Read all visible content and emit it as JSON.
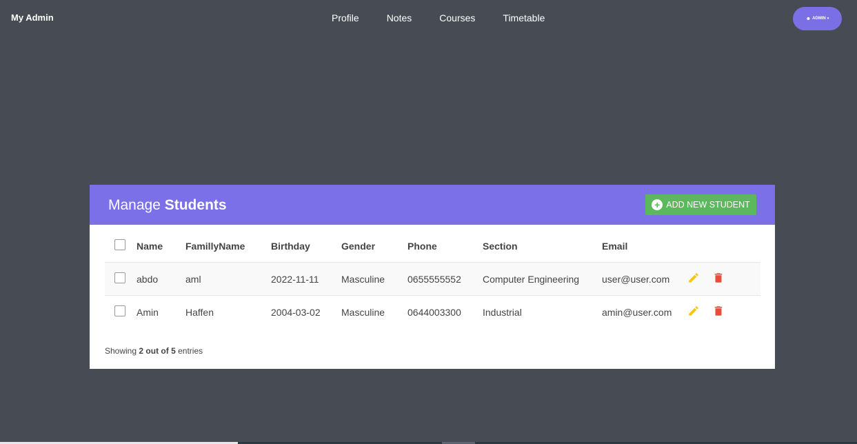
{
  "header": {
    "brand": "My Admin",
    "nav": [
      "Profile",
      "Notes",
      "Courses",
      "Timetable"
    ],
    "admin_label": "ADMIN"
  },
  "panel": {
    "title_light": "Manage",
    "title_bold": "Students",
    "add_label": "ADD NEW STUDENT"
  },
  "table": {
    "columns": [
      "Name",
      "FamillyName",
      "Birthday",
      "Gender",
      "Phone",
      "Section",
      "Email"
    ],
    "rows": [
      [
        "abdo",
        "aml",
        "2022-11-11",
        "Masculine",
        "0655555552",
        "Computer Engineering",
        "user@user.com"
      ],
      [
        "Amin",
        "Haffen",
        "2004-03-02",
        "Masculine",
        "0644003300",
        "Industrial",
        "amin@user.com"
      ]
    ]
  },
  "footer": {
    "prefix": "Showing",
    "shown": "2",
    "of_text": "out of",
    "total": "5",
    "suffix": "entries"
  },
  "colors": {
    "background": "#474b53",
    "accent": "#7b70e8",
    "add_button": "#5cb85c",
    "edit_icon": "#f5c518",
    "delete_icon": "#e74c3c"
  }
}
